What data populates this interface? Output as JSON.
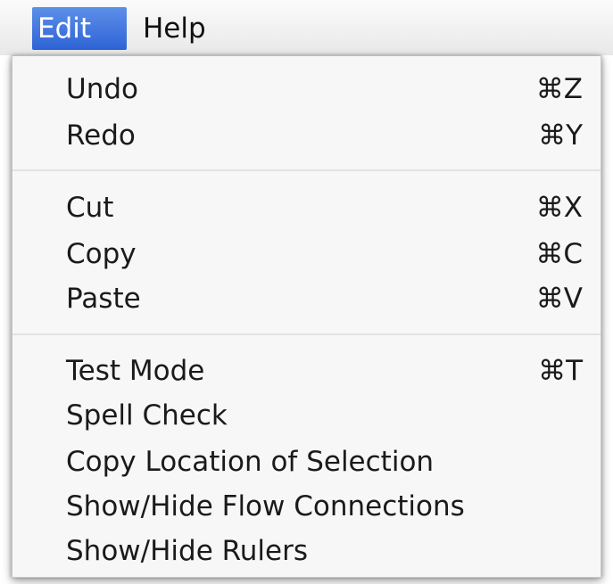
{
  "menubar": {
    "edit_label": "Edit",
    "help_label": "Help"
  },
  "menu": {
    "undo": {
      "label": "Undo",
      "shortcut": "⌘Z"
    },
    "redo": {
      "label": "Redo",
      "shortcut": "⌘Y"
    },
    "cut": {
      "label": "Cut",
      "shortcut": "⌘X"
    },
    "copy": {
      "label": "Copy",
      "shortcut": "⌘C"
    },
    "paste": {
      "label": "Paste",
      "shortcut": "⌘V"
    },
    "test_mode": {
      "label": "Test Mode",
      "shortcut": "⌘T"
    },
    "spell_check": {
      "label": "Spell Check"
    },
    "copy_location": {
      "label": "Copy Location of Selection"
    },
    "flow_connections": {
      "label": "Show/Hide Flow Connections"
    },
    "rulers": {
      "label": "Show/Hide Rulers"
    }
  },
  "colors": {
    "active_menu": "#3b73dc",
    "menu_background": "#f7f7f7"
  }
}
